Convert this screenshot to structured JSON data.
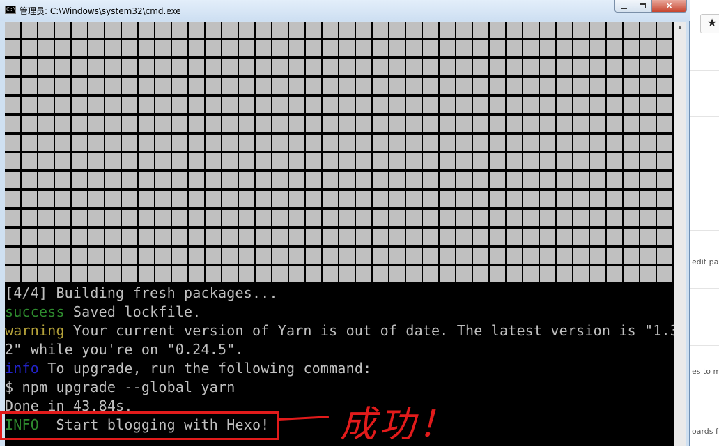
{
  "window": {
    "title": "管理员: C:\\Windows\\system32\\cmd.exe",
    "icon_label": "C:\\"
  },
  "console": {
    "lines": [
      {
        "prefix": "",
        "text": "[4/4] Building fresh packages..."
      },
      {
        "prefix": "success",
        "text": " Saved lockfile."
      },
      {
        "prefix": "warning",
        "text": " Your current version of Yarn is out of date. The latest version is \"1.3."
      },
      {
        "prefix": "",
        "text": "2\" while you're on \"0.24.5\"."
      },
      {
        "prefix": "info",
        "text": " To upgrade, run the following command:"
      },
      {
        "prefix": "",
        "text": "$ npm upgrade --global yarn"
      },
      {
        "prefix": "",
        "text": "Done in 43.84s."
      },
      {
        "prefix": "INFO",
        "text": "  Start blogging with Hexo!"
      }
    ],
    "colors": {
      "success": "#2e8b2e",
      "warning": "#b5a23a",
      "info": "#2323c9",
      "INFO": "#2e8b2e"
    }
  },
  "annotation": {
    "text": "成功！",
    "color": "#e21b1b"
  },
  "background_page": {
    "star": "★",
    "snippets": [
      "edit pa",
      "es to m",
      "oards f"
    ]
  }
}
